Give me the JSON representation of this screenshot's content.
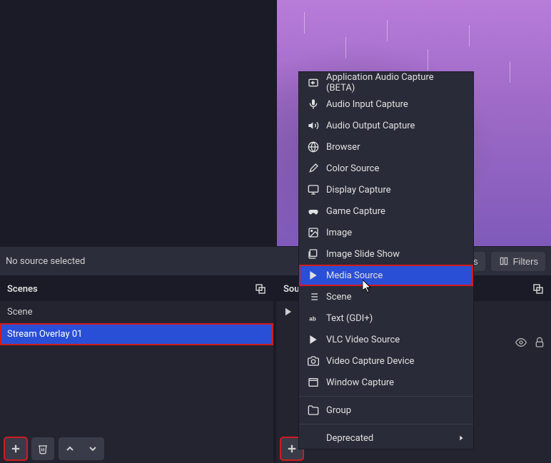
{
  "toolbar": {
    "status": "No source selected",
    "properties": "Properties",
    "filters": "Filters"
  },
  "panels": {
    "scenes": {
      "title": "Scenes",
      "items": [
        "Scene",
        "Stream Overlay 01"
      ],
      "selected_index": 1
    },
    "sources": {
      "title": "Sou"
    }
  },
  "context_menu": {
    "items": [
      {
        "icon": "app-audio",
        "label": "Application Audio Capture (BETA)"
      },
      {
        "icon": "mic",
        "label": "Audio Input Capture"
      },
      {
        "icon": "speaker",
        "label": "Audio Output Capture"
      },
      {
        "icon": "globe",
        "label": "Browser"
      },
      {
        "icon": "brush",
        "label": "Color Source"
      },
      {
        "icon": "monitor",
        "label": "Display Capture"
      },
      {
        "icon": "gamepad",
        "label": "Game Capture"
      },
      {
        "icon": "image",
        "label": "Image"
      },
      {
        "icon": "slides",
        "label": "Image Slide Show"
      },
      {
        "icon": "play",
        "label": "Media Source"
      },
      {
        "icon": "list",
        "label": "Scene"
      },
      {
        "icon": "text",
        "label": "Text (GDI+)"
      },
      {
        "icon": "vlc",
        "label": "VLC Video Source"
      },
      {
        "icon": "camera",
        "label": "Video Capture Device"
      },
      {
        "icon": "window",
        "label": "Window Capture"
      }
    ],
    "group_label": "Group",
    "deprecated_label": "Deprecated",
    "highlighted_index": 9
  }
}
